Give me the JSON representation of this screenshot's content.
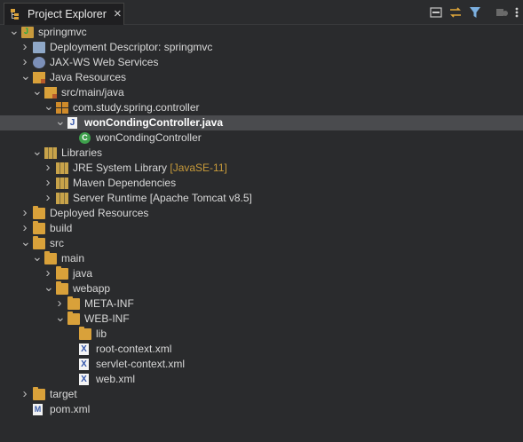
{
  "view": {
    "title": "Project Explorer",
    "close_glyph": "×",
    "toolbar_icons": [
      "collapse-all-icon",
      "link-with-editor-icon",
      "filter-icon",
      "focus-icon",
      "view-menu-icon"
    ]
  },
  "tree": [
    {
      "label": "springmvc",
      "indent": 0,
      "arrow": "expanded",
      "icon": "project-icon"
    },
    {
      "label": "Deployment Descriptor: springmvc",
      "indent": 1,
      "arrow": "collapsed",
      "icon": "deployment-descriptor-icon"
    },
    {
      "label": "JAX-WS Web Services",
      "indent": 1,
      "arrow": "collapsed",
      "icon": "web-services-icon"
    },
    {
      "label": "Java Resources",
      "indent": 1,
      "arrow": "expanded",
      "icon": "java-resources-icon"
    },
    {
      "label": "src/main/java",
      "indent": 2,
      "arrow": "expanded",
      "icon": "source-folder-icon"
    },
    {
      "label": "com.study.spring.controller",
      "indent": 3,
      "arrow": "expanded",
      "icon": "package-icon"
    },
    {
      "label": "wonCondingController.java",
      "indent": 4,
      "arrow": "expanded",
      "icon": "java-file-icon",
      "selected": true
    },
    {
      "label": "wonCondingController",
      "indent": 5,
      "arrow": "none",
      "icon": "class-icon"
    },
    {
      "label": "Libraries",
      "indent": 2,
      "arrow": "expanded",
      "icon": "libraries-icon"
    },
    {
      "label": "JRE System Library",
      "decoration": "[JavaSE-11]",
      "indent": 3,
      "arrow": "collapsed",
      "icon": "library-icon"
    },
    {
      "label": "Maven Dependencies",
      "indent": 3,
      "arrow": "collapsed",
      "icon": "library-icon"
    },
    {
      "label": "Server Runtime [Apache Tomcat v8.5]",
      "indent": 3,
      "arrow": "collapsed",
      "icon": "library-icon"
    },
    {
      "label": "Deployed Resources",
      "indent": 1,
      "arrow": "collapsed",
      "icon": "folder-icon"
    },
    {
      "label": "build",
      "indent": 1,
      "arrow": "collapsed",
      "icon": "folder-icon"
    },
    {
      "label": "src",
      "indent": 1,
      "arrow": "expanded",
      "icon": "folder-icon"
    },
    {
      "label": "main",
      "indent": 2,
      "arrow": "expanded",
      "icon": "folder-icon"
    },
    {
      "label": "java",
      "indent": 3,
      "arrow": "collapsed",
      "icon": "folder-icon"
    },
    {
      "label": "webapp",
      "indent": 3,
      "arrow": "expanded",
      "icon": "folder-icon"
    },
    {
      "label": "META-INF",
      "indent": 4,
      "arrow": "collapsed",
      "icon": "folder-icon"
    },
    {
      "label": "WEB-INF",
      "indent": 4,
      "arrow": "expanded",
      "icon": "folder-icon"
    },
    {
      "label": "lib",
      "indent": 5,
      "arrow": "none",
      "icon": "folder-icon"
    },
    {
      "label": "root-context.xml",
      "indent": 5,
      "arrow": "none",
      "icon": "xml-file-icon"
    },
    {
      "label": "servlet-context.xml",
      "indent": 5,
      "arrow": "none",
      "icon": "xml-file-icon"
    },
    {
      "label": "web.xml",
      "indent": 5,
      "arrow": "none",
      "icon": "xml-file-icon"
    },
    {
      "label": "target",
      "indent": 1,
      "arrow": "collapsed",
      "icon": "folder-icon"
    },
    {
      "label": "pom.xml",
      "indent": 1,
      "arrow": "none",
      "icon": "pom-file-icon"
    }
  ]
}
